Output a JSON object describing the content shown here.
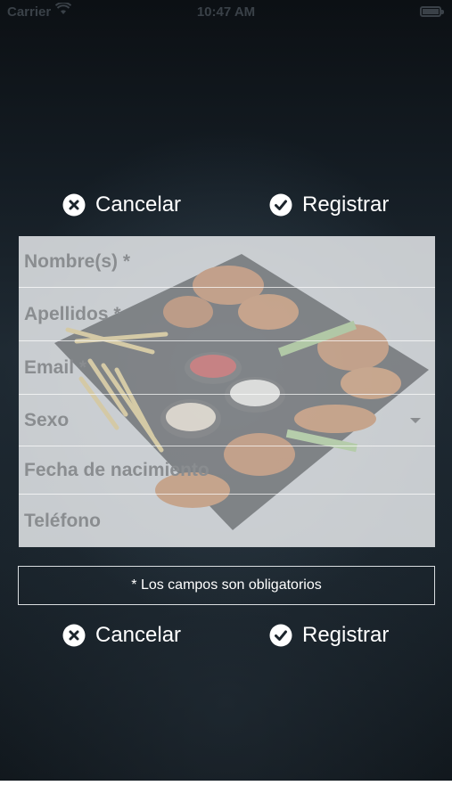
{
  "status_bar": {
    "carrier": "Carrier",
    "time": "10:47 AM"
  },
  "actions_top": {
    "cancel_label": "Cancelar",
    "register_label": "Registrar"
  },
  "actions_bottom": {
    "cancel_label": "Cancelar",
    "register_label": "Registrar"
  },
  "form": {
    "fields": [
      {
        "placeholder": "Nombre(s) *"
      },
      {
        "placeholder": "Apellidos *"
      },
      {
        "placeholder": "Email *"
      },
      {
        "placeholder": "Sexo"
      },
      {
        "placeholder": "Fecha de nacimiento"
      },
      {
        "placeholder": "Teléfono"
      }
    ]
  },
  "required_note": "* Los campos son obligatorios",
  "icons": {
    "cancel": "close-circle-icon",
    "register": "check-circle-icon",
    "dropdown": "chevron-down-icon"
  }
}
